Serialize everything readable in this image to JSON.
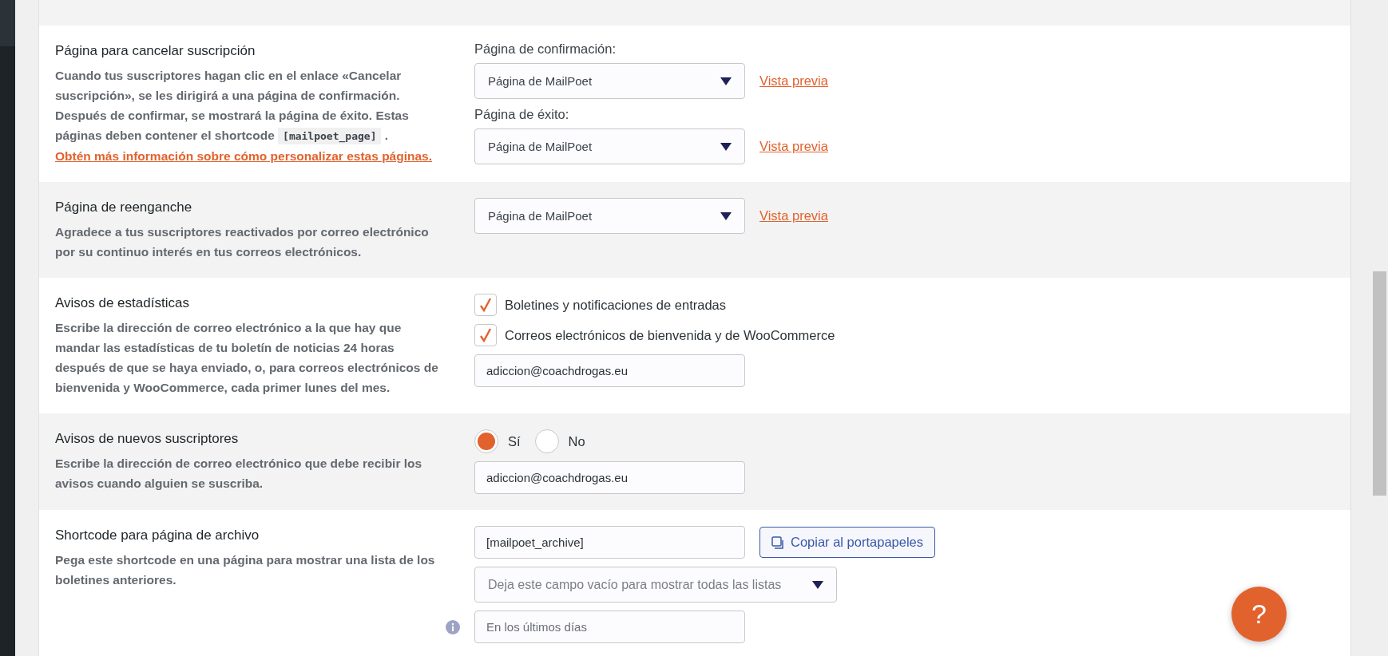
{
  "sections": [
    {
      "title": "Página para cancelar suscripción",
      "description": [
        {
          "kind": "text",
          "text": "Cuando tus suscriptores hagan clic en el enlace «Cancelar suscripción», se les dirigirá a una página de confirmación. Después de confirmar, se mostrará la página de éxito. Estas páginas deben contener el shortcode "
        },
        {
          "kind": "code",
          "text": "[mailpoet_page]"
        },
        {
          "kind": "text",
          "text": " . "
        },
        {
          "kind": "link",
          "text": "Obtén más información sobre cómo personalizar estas páginas."
        }
      ],
      "controls": [
        {
          "kind": "select",
          "label": "Página de confirmación:",
          "value": "Página de MailPoet",
          "link": "Vista previa"
        },
        {
          "kind": "select",
          "label": "Página de éxito:",
          "value": "Página de MailPoet",
          "link": "Vista previa"
        }
      ]
    },
    {
      "title": "Página de reenganche",
      "description": [
        {
          "kind": "text",
          "text": "Agradece a tus suscriptores reactivados por correo electrónico por su continuo interés en tus correos electrónicos."
        }
      ],
      "controls": [
        {
          "kind": "select",
          "value": "Página de MailPoet",
          "link": "Vista previa"
        }
      ]
    },
    {
      "title": "Avisos de estadísticas",
      "description": [
        {
          "kind": "text",
          "text": "Escribe la dirección de correo electrónico a la que hay que mandar las estadísticas de tu boletín de noticias 24 horas después de que se haya enviado, o, para correos electrónicos de bienvenida y WooCommerce, cada primer lunes del mes."
        }
      ],
      "controls": [
        {
          "kind": "checkbox",
          "label": "Boletines y notificaciones de entradas",
          "checked": true
        },
        {
          "kind": "checkbox",
          "label": "Correos electrónicos de bienvenida y de WooCommerce",
          "checked": true
        },
        {
          "kind": "input",
          "value": "adiccion@coachdrogas.eu"
        }
      ]
    },
    {
      "title": "Avisos de nuevos suscriptores",
      "description": [
        {
          "kind": "text",
          "text": "Escribe la dirección de correo electrónico que debe recibir los avisos cuando alguien se suscriba."
        }
      ],
      "controls": [
        {
          "kind": "radios",
          "options": [
            {
              "label": "Sí",
              "selected": true
            },
            {
              "label": "No",
              "selected": false
            }
          ]
        },
        {
          "kind": "input",
          "value": "adiccion@coachdrogas.eu"
        }
      ]
    },
    {
      "title": "Shortcode para página de archivo",
      "description": [
        {
          "kind": "text",
          "text": "Pega este shortcode en una página para mostrar una lista de los boletines anteriores."
        }
      ],
      "controls": [
        {
          "kind": "input",
          "value": "[mailpoet_archive]",
          "button": "Copiar al portapapeles"
        },
        {
          "kind": "select",
          "placeholder": "Deja este campo vacío para mostrar todas las listas",
          "wide": true
        },
        {
          "kind": "input",
          "placeholder": "En los últimos días",
          "info": true
        }
      ]
    }
  ],
  "help_button": "?"
}
